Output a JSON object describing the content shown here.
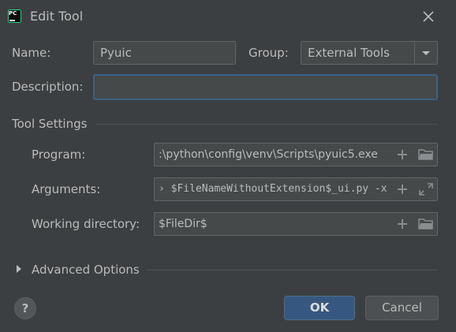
{
  "window": {
    "title": "Edit Tool",
    "icon": "pycharm-logo-icon",
    "icon_text": "PC"
  },
  "form": {
    "name_label": "Name:",
    "name_value": "Pyuic",
    "group_label": "Group:",
    "group_value": "External Tools",
    "description_label": "Description:",
    "description_value": ""
  },
  "tool_settings": {
    "title": "Tool Settings",
    "program_label": "Program:",
    "program_value": ":\\python\\config\\venv\\Scripts\\pyuic5.exe",
    "arguments_label": "Arguments:",
    "arguments_value": "› $FileNameWithoutExtension$_ui.py -x",
    "working_dir_label": "Working directory:",
    "working_dir_value": "$FileDir$"
  },
  "advanced": {
    "label": "Advanced Options",
    "expanded": false
  },
  "footer": {
    "help_label": "?",
    "ok_label": "OK",
    "cancel_label": "Cancel"
  },
  "colors": {
    "background": "#3c3f41",
    "field_background": "#45494a",
    "focus_border": "#3d6185",
    "primary_button": "#365880",
    "text": "#bbbbbb"
  }
}
